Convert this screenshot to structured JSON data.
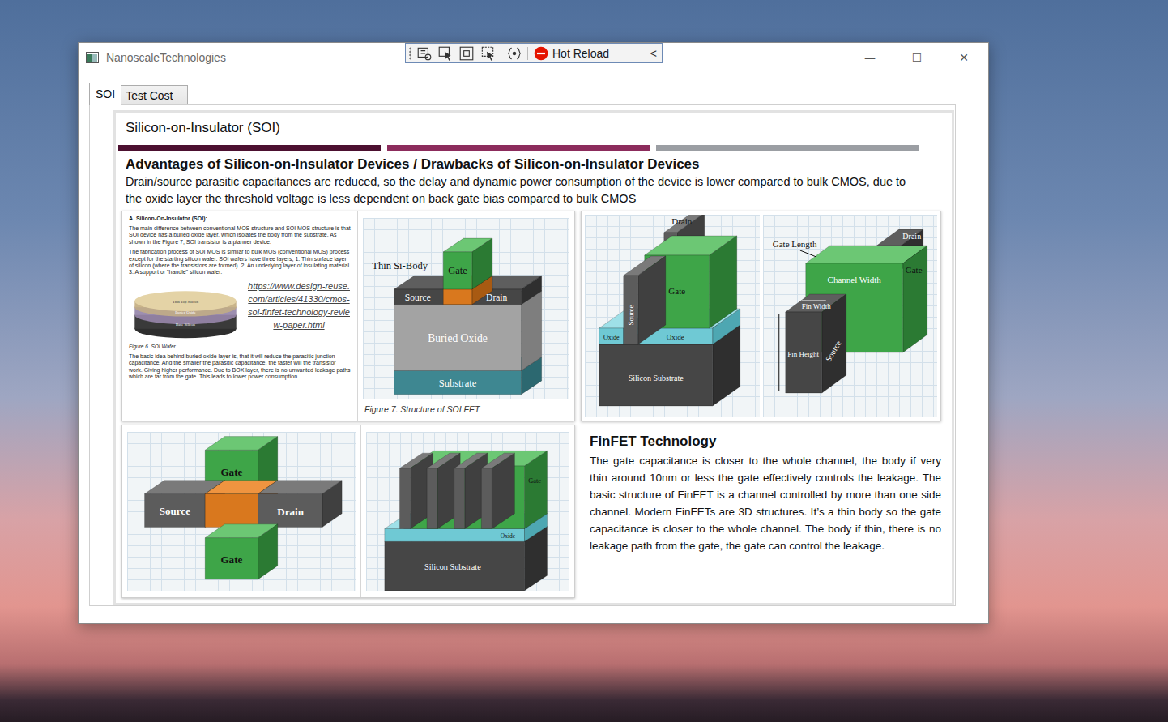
{
  "window": {
    "title": "NanoscaleTechnologies",
    "controls": {
      "minimize": "—",
      "maximize": "☐",
      "close": "✕"
    }
  },
  "debug_toolbar": {
    "label": "Hot Reload",
    "collapse": "<"
  },
  "tabs": [
    {
      "label": "SOI",
      "selected": true
    },
    {
      "label": "Test Cost",
      "selected": false
    },
    {
      "label": "",
      "selected": false
    }
  ],
  "page": {
    "title": "Silicon-on-Insulator (SOI)",
    "bars": [
      {
        "color": "#4c1030"
      },
      {
        "color": "#8c2c5c"
      },
      {
        "color": "#9b9ea3"
      }
    ],
    "heading": "Advantages of Silicon-on-Insulator Devices / Drawbacks of Silicon-on-Insulator Devices",
    "text": "Drain/source parasitic capacitances are reduced, so the delay and dynamic power consumption of the device is lower compared to bulk CMOS, due to the oxide layer the threshold voltage is less dependent on back gate bias compared to bulk CMOS"
  },
  "document": {
    "heading": "A. Silicon-On-Insulator (SOI):",
    "paragraph1": "The main difference between conventional MOS structure and SOI MOS structure is that SOI device has a buried oxide layer, which isolates the body from the substrate. As shown in the Figure 7, SOI transistor is a planner device.",
    "paragraph2": "The fabrication process of SOI MOS is similar to bulk MOS (conventional MOS) process except for the starting silicon wafer. SOI wafers have three layers; 1. Thin surface layer of silicon (where the transistors are formed). 2. An underlying layer of insulating material. 3. A support or \"handle\" silicon wafer.",
    "wafer": {
      "top": "Thin Top Silicon",
      "middle": "Buried Oxide",
      "base": "Base Silicon"
    },
    "link": "https://www.design-reuse.com/articles/41330/cmos-soi-finfet-technology-review-paper.html",
    "caption": "Figure 6. SOI Wafer",
    "paragraph3": "The basic idea behind buried oxide layer is, that it will reduce the parasitic junction capacitance. And the smaller the parasitic capacitance, the faster will the transistor work. Giving higher performance. Due to BOX layer, there is no unwanted leakage paths which are far from the gate. This leads to lower power consumption."
  },
  "soi_fet": {
    "thin_body": "Thin Si-Body",
    "gate": "Gate",
    "source": "Source",
    "drain": "Drain",
    "oxide": "Buried Oxide",
    "substrate": "Substrate",
    "caption": "Figure 7. Structure of SOI FET"
  },
  "finfet": {
    "drain": "Drain",
    "gate": "Gate",
    "source": "Source",
    "oxide_left": "Oxide",
    "oxide_right": "Oxide",
    "substrate": "Silicon Substrate"
  },
  "fin_dimensions": {
    "gate_length": "Gate Length",
    "drain": "Drain",
    "gate": "Gate",
    "channel_width": "Channel Width",
    "fin_width": "Fin Width",
    "fin_height": "Fin Height",
    "source": "Source"
  },
  "double_gate": {
    "gate_top": "Gate",
    "source": "Source",
    "drain": "Drain",
    "gate_bottom": "Gate"
  },
  "multi_fin": {
    "gate": "Gate",
    "oxide": "Oxide",
    "substrate": "Silicon Substrate"
  },
  "finfet_section": {
    "title": "FinFET Technology",
    "text": "The gate capacitance is closer to the whole channel, the body if very thin around 10nm or less the gate effectively controls the leakage. The basic structure of FinFET is a channel controlled by more than one side channel.  Modern FinFETs are 3D structures. It’s a thin body so the gate capacitance is closer to the whole channel.  The body if thin, there is no leakage path from the gate, the gate can control the leakage."
  }
}
